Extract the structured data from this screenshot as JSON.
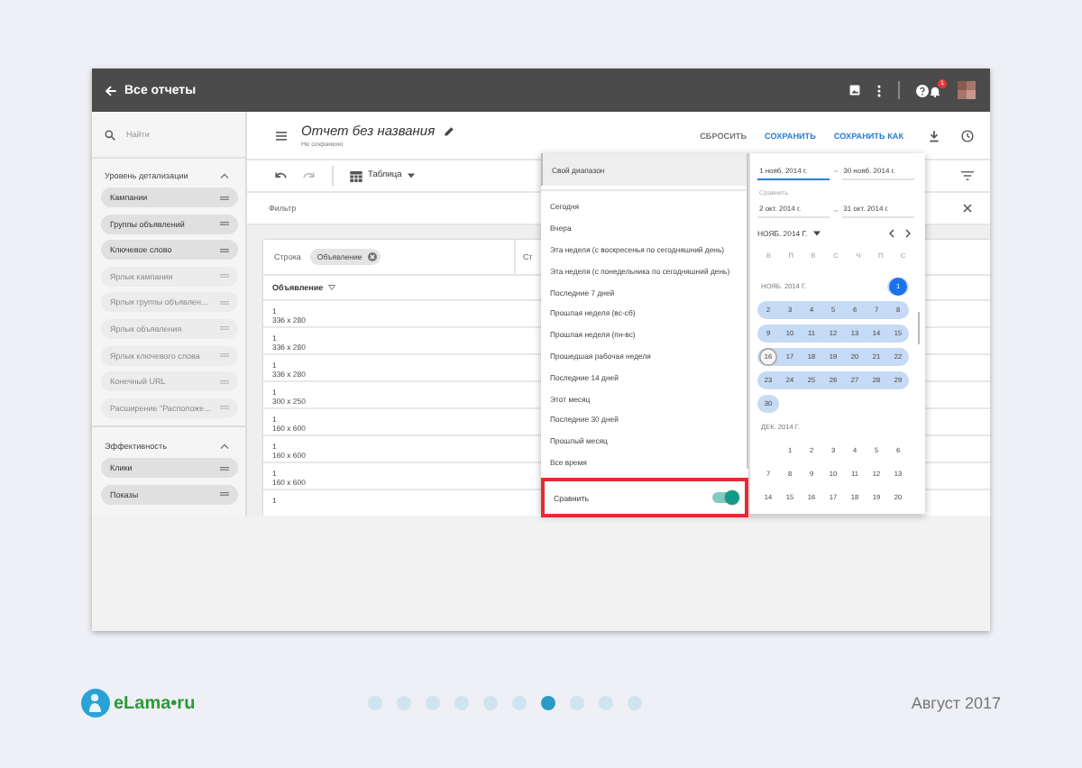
{
  "topbar": {
    "title": "Все отчеты",
    "notification_count": "1"
  },
  "sidebar": {
    "search": {
      "placeholder": "Найти"
    },
    "sections": [
      {
        "title": "Уровень детализации",
        "expanded": true,
        "items": [
          {
            "label": "Кампании",
            "disabled": false
          },
          {
            "label": "Группы объявлений",
            "disabled": false
          },
          {
            "label": "Ключевое слово",
            "disabled": false
          },
          {
            "label": "Ярлык кампании",
            "disabled": true
          },
          {
            "label": "Ярлык группы объявлен...",
            "disabled": true
          },
          {
            "label": "Ярлык объявления",
            "disabled": true
          },
          {
            "label": "Ярлык ключевого слова",
            "disabled": true
          },
          {
            "label": "Конечный URL",
            "disabled": true
          },
          {
            "label": "Расширение \"Расположе...",
            "disabled": true
          }
        ]
      },
      {
        "title": "Эффективность",
        "expanded": true,
        "items": [
          {
            "label": "Клики",
            "disabled": false
          },
          {
            "label": "Показы",
            "disabled": false
          }
        ]
      }
    ]
  },
  "report": {
    "title": "Отчет без названия",
    "status": "Не сохранено",
    "actions": [
      {
        "label": "СБРОСИТЬ",
        "kind": "plain"
      },
      {
        "label": "СОХРАНИТЬ",
        "kind": "primary"
      },
      {
        "label": "СОХРАНИТЬ КАК",
        "kind": "primary"
      }
    ],
    "view": "Таблица",
    "filter": {
      "placeholder": "Фильтр"
    }
  },
  "table": {
    "row_label": "Строка",
    "row_chips": [
      "Объявление"
    ],
    "column_label": "Ст",
    "column_header": "Объявление",
    "rows": [
      {
        "title": "1",
        "size": "336 x 280"
      },
      {
        "title": "1",
        "size": "336 x 280"
      },
      {
        "title": "1",
        "size": "336 x 280"
      },
      {
        "title": "1",
        "size": "300 x 250"
      },
      {
        "title": "1",
        "size": "160 x 600"
      },
      {
        "title": "1",
        "size": "160 x 600"
      },
      {
        "title": "1",
        "size": "160 x 600"
      },
      {
        "title": "1"
      }
    ]
  },
  "date_menu": {
    "items": [
      {
        "label": "Свой диапазон",
        "selected": true
      },
      {
        "label": "Сегодня",
        "selected": false
      },
      {
        "label": "Вчера",
        "selected": false
      },
      {
        "label": "Эта неделя (с воскресенья по сегодняшний день)",
        "selected": false
      },
      {
        "label": "Эта неделя (с понедельника по сегодняшний день)",
        "selected": false
      },
      {
        "label": "Последние 7 дней",
        "selected": false
      },
      {
        "label": "Прошлая неделя (вс-сб)",
        "selected": false
      },
      {
        "label": "Прошлая неделя (пн-вс)",
        "selected": false
      },
      {
        "label": "Прошедшая рабочая неделя",
        "selected": false
      },
      {
        "label": "Последние 14 дней",
        "selected": false
      },
      {
        "label": "Этот месяц",
        "selected": false
      },
      {
        "label": "Последние 30 дней",
        "selected": false
      },
      {
        "label": "Прошлый месяц",
        "selected": false
      },
      {
        "label": "Все время",
        "selected": false
      }
    ],
    "compare": {
      "label": "Сравнить",
      "on": true
    }
  },
  "calendar": {
    "start": "1 нояб. 2014 г.",
    "separator": "–",
    "end": "30 нояб. 2014 г.",
    "compare_label": "Сравнить",
    "compare_start": "2 окт. 2014 г.",
    "compare_separator": "–",
    "compare_end": "31 окт. 2014 г.",
    "month_picker": "НОЯБ. 2014 Г.",
    "weekdays": [
      "В",
      "П",
      "В",
      "С",
      "Ч",
      "П",
      "С"
    ],
    "months": [
      {
        "title": "НОЯБ. 2014 Г.",
        "weeks": [
          [
            {
              "day": "1",
              "in_range": true,
              "selected": true,
              "today": false
            }
          ],
          [
            {
              "day": "2",
              "in_range": true,
              "selected": false,
              "today": false
            },
            {
              "day": "3",
              "in_range": true,
              "selected": false,
              "today": false
            },
            {
              "day": "4",
              "in_range": true,
              "selected": false,
              "today": false
            },
            {
              "day": "5",
              "in_range": true,
              "selected": false,
              "today": false
            },
            {
              "day": "6",
              "in_range": true,
              "selected": false,
              "today": false
            },
            {
              "day": "7",
              "in_range": true,
              "selected": false,
              "today": false
            },
            {
              "day": "8",
              "in_range": true,
              "selected": false,
              "today": false
            }
          ],
          [
            {
              "day": "9",
              "in_range": true,
              "selected": false,
              "today": false
            },
            {
              "day": "10",
              "in_range": true,
              "selected": false,
              "today": false
            },
            {
              "day": "11",
              "in_range": true,
              "selected": false,
              "today": false
            },
            {
              "day": "12",
              "in_range": true,
              "selected": false,
              "today": false
            },
            {
              "day": "13",
              "in_range": true,
              "selected": false,
              "today": false
            },
            {
              "day": "14",
              "in_range": true,
              "selected": false,
              "today": false
            },
            {
              "day": "15",
              "in_range": true,
              "selected": false,
              "today": false
            }
          ],
          [
            {
              "day": "16",
              "in_range": true,
              "selected": false,
              "today": true
            },
            {
              "day": "17",
              "in_range": true,
              "selected": false,
              "today": false
            },
            {
              "day": "18",
              "in_range": true,
              "selected": false,
              "today": false
            },
            {
              "day": "19",
              "in_range": true,
              "selected": false,
              "today": false
            },
            {
              "day": "20",
              "in_range": true,
              "selected": false,
              "today": false
            },
            {
              "day": "21",
              "in_range": true,
              "selected": false,
              "today": false
            },
            {
              "day": "22",
              "in_range": true,
              "selected": false,
              "today": false
            }
          ],
          [
            {
              "day": "23",
              "in_range": true,
              "selected": false,
              "today": false
            },
            {
              "day": "24",
              "in_range": true,
              "selected": false,
              "today": false
            },
            {
              "day": "25",
              "in_range": true,
              "selected": false,
              "today": false
            },
            {
              "day": "26",
              "in_range": true,
              "selected": false,
              "today": false
            },
            {
              "day": "27",
              "in_range": true,
              "selected": false,
              "today": false
            },
            {
              "day": "28",
              "in_range": true,
              "selected": false,
              "today": false
            },
            {
              "day": "29",
              "in_range": true,
              "selected": false,
              "today": false
            }
          ],
          [
            {
              "day": "30",
              "in_range": true,
              "selected": false,
              "today": false
            }
          ]
        ]
      },
      {
        "title": "ДЕК. 2014 Г.",
        "weeks": [
          [
            {
              "day": "1",
              "in_range": false,
              "selected": false,
              "today": false
            },
            {
              "day": "2",
              "in_range": false,
              "selected": false,
              "today": false
            },
            {
              "day": "3",
              "in_range": false,
              "selected": false,
              "today": false
            },
            {
              "day": "4",
              "in_range": false,
              "selected": false,
              "today": false
            },
            {
              "day": "5",
              "in_range": false,
              "selected": false,
              "today": false
            },
            {
              "day": "6",
              "in_range": false,
              "selected": false,
              "today": false
            }
          ],
          [
            {
              "day": "7",
              "in_range": false,
              "selected": false,
              "today": false
            },
            {
              "day": "8",
              "in_range": false,
              "selected": false,
              "today": false
            },
            {
              "day": "9",
              "in_range": false,
              "selected": false,
              "today": false
            },
            {
              "day": "10",
              "in_range": false,
              "selected": false,
              "today": false
            },
            {
              "day": "11",
              "in_range": false,
              "selected": false,
              "today": false
            },
            {
              "day": "12",
              "in_range": false,
              "selected": false,
              "today": false
            },
            {
              "day": "13",
              "in_range": false,
              "selected": false,
              "today": false
            }
          ],
          [
            {
              "day": "14",
              "in_range": false,
              "selected": false,
              "today": false
            },
            {
              "day": "15",
              "in_range": false,
              "selected": false,
              "today": false
            },
            {
              "day": "16",
              "in_range": false,
              "selected": false,
              "today": false
            },
            {
              "day": "17",
              "in_range": false,
              "selected": false,
              "today": false
            },
            {
              "day": "18",
              "in_range": false,
              "selected": false,
              "today": false
            },
            {
              "day": "19",
              "in_range": false,
              "selected": false,
              "today": false
            },
            {
              "day": "20",
              "in_range": false,
              "selected": false,
              "today": false
            }
          ]
        ]
      }
    ]
  },
  "footer": {
    "logo": "eLama•ru",
    "date": "Август 2017",
    "pages": [
      {
        "selected": false
      },
      {
        "selected": false
      },
      {
        "selected": false
      },
      {
        "selected": false
      },
      {
        "selected": false
      },
      {
        "selected": false
      },
      {
        "selected": true
      },
      {
        "selected": false
      },
      {
        "selected": false
      },
      {
        "selected": false
      }
    ]
  }
}
